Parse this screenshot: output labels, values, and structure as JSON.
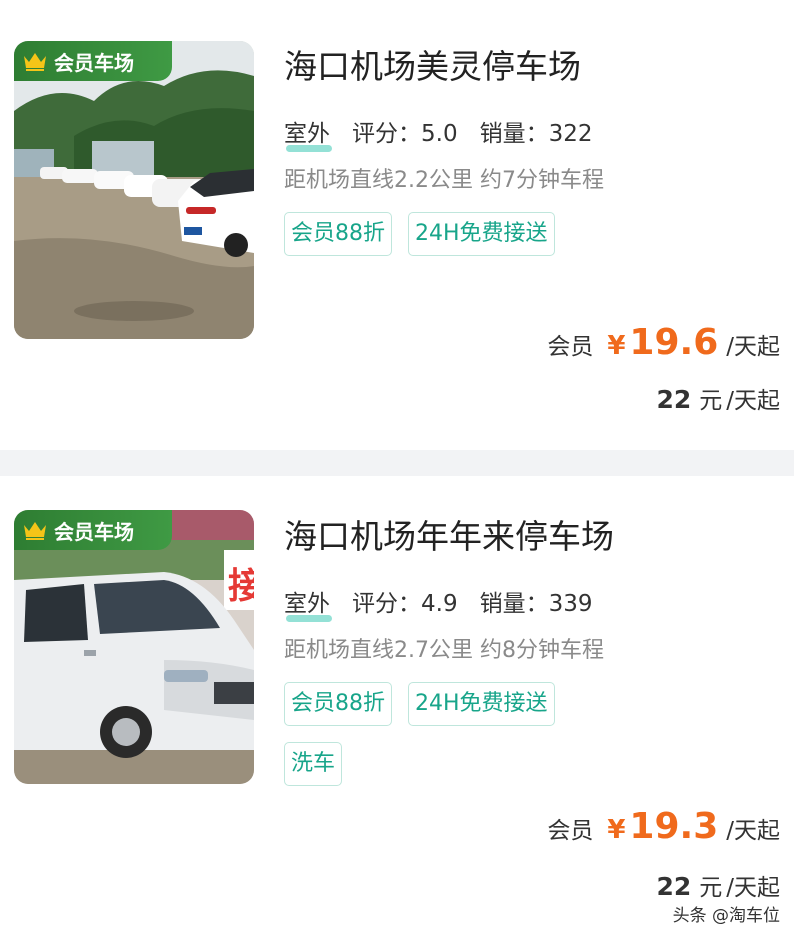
{
  "badge": "会员车场",
  "listings": [
    {
      "title": "海口机场美灵停车场",
      "type": "室外",
      "rating_label": "评分：",
      "rating": "5.0",
      "sales_label": "销量：",
      "sales": "322",
      "distance": "距机场直线2.2公里 约7分钟车程",
      "tags": [
        "会员88折",
        "24H免费接送"
      ],
      "member_label": "会员",
      "currency": "¥",
      "member_price": "19.6",
      "per_day": "/天起",
      "normal_price": "22",
      "normal_unit": "元"
    },
    {
      "title": "海口机场年年来停车场",
      "type": "室外",
      "rating_label": "评分：",
      "rating": "4.9",
      "sales_label": "销量：",
      "sales": "339",
      "distance": "距机场直线2.7公里 约8分钟车程",
      "tags": [
        "会员88折",
        "24H免费接送",
        "洗车"
      ],
      "member_label": "会员",
      "currency": "¥",
      "member_price": "19.3",
      "per_day": "/天起",
      "normal_price": "22",
      "normal_unit": "元"
    }
  ],
  "photo2_sign": "接",
  "watermark": "头条 @淘车位",
  "colors": {
    "accent": "#f06a1c",
    "tag": "#18a58a",
    "badge": "#2e7d32"
  }
}
